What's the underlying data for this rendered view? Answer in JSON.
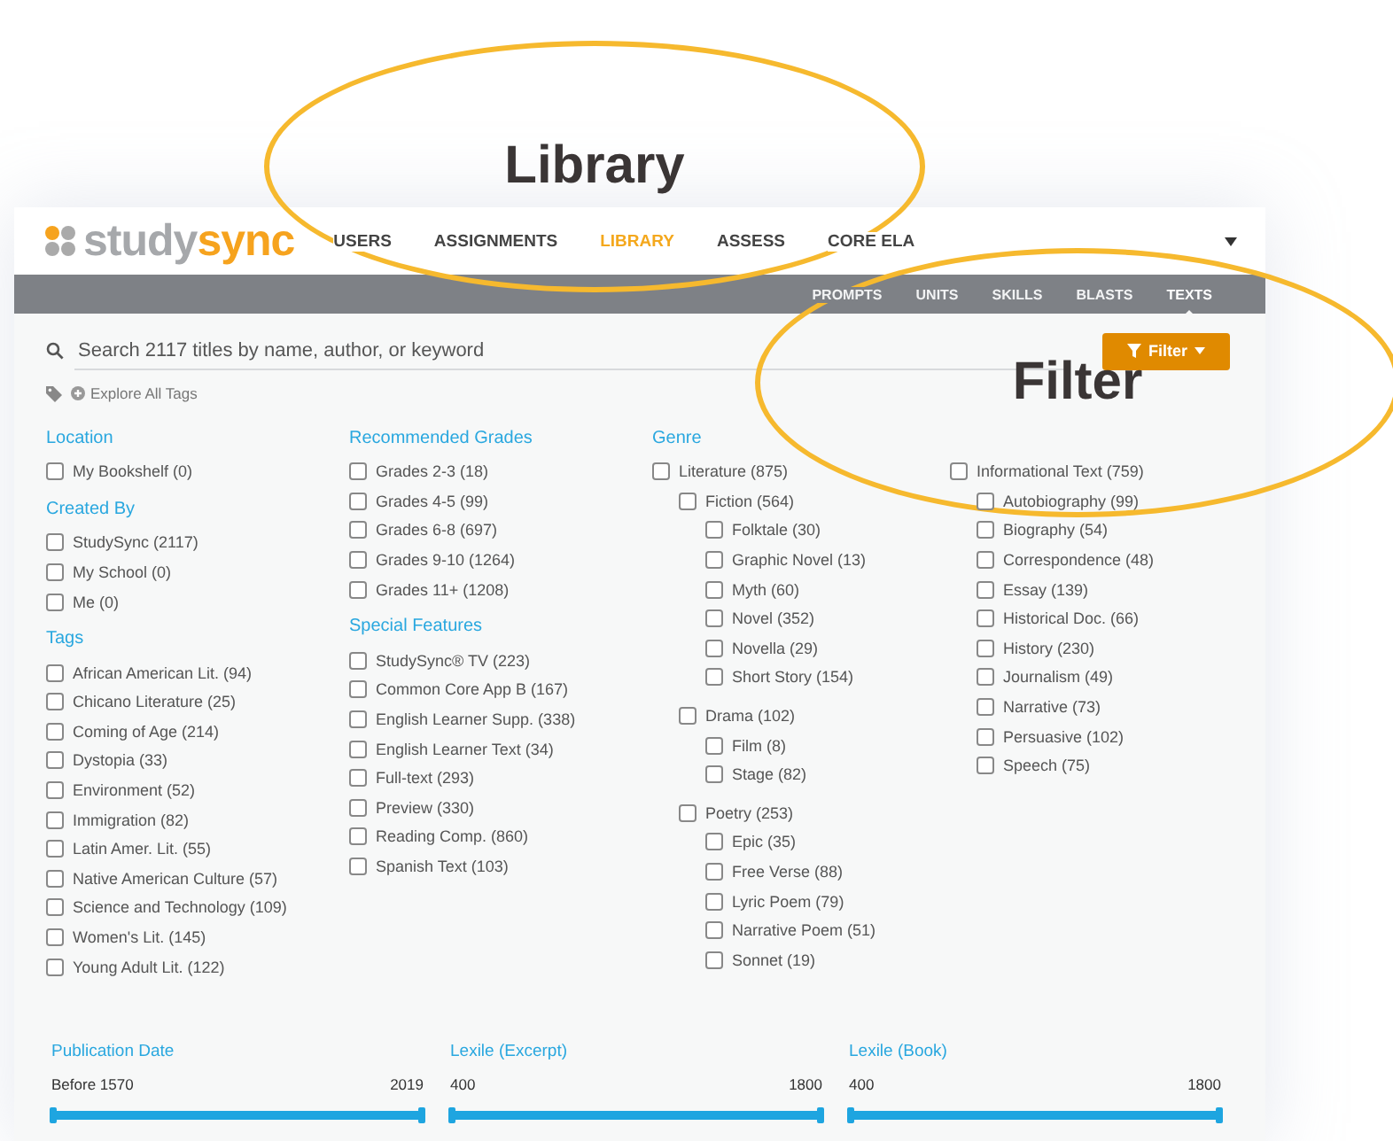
{
  "callouts": [
    {
      "kind": "library",
      "label": "Library"
    },
    {
      "kind": "filter",
      "label": "Filter"
    }
  ],
  "header": {
    "logo": [
      "study",
      "sync"
    ],
    "nav": [
      {
        "label": "USERS",
        "selected": false
      },
      {
        "label": "ASSIGNMENTS",
        "selected": false
      },
      {
        "label": "LIBRARY",
        "selected": true
      },
      {
        "label": "ASSESS",
        "selected": false
      },
      {
        "label": "CORE ELA",
        "selected": false
      }
    ],
    "subnav": [
      {
        "label": "PROMPTS",
        "selected": false
      },
      {
        "label": "UNITS",
        "selected": false
      },
      {
        "label": "SKILLS",
        "selected": false
      },
      {
        "label": "BLASTS",
        "selected": false
      },
      {
        "label": "TEXTS",
        "selected": true
      }
    ]
  },
  "search": {
    "placeholder": "Search 2117 titles by name, author, or keyword"
  },
  "filter_button": {
    "label": "Filter"
  },
  "tags_link": "Explore All Tags",
  "columns": [
    [
      {
        "title": "Location",
        "items": [
          {
            "label": "My Bookshelf (0)",
            "checked": false
          }
        ]
      },
      {
        "title": "Created By",
        "items": [
          {
            "label": "StudySync (2117)",
            "checked": false
          },
          {
            "label": "My School (0)",
            "checked": false
          },
          {
            "label": "Me (0)",
            "checked": false
          }
        ]
      },
      {
        "title": "Tags",
        "items": [
          {
            "label": "African American Lit. (94)",
            "checked": false
          },
          {
            "label": "Chicano Literature (25)",
            "checked": false
          },
          {
            "label": "Coming of Age (214)",
            "checked": false
          },
          {
            "label": "Dystopia (33)",
            "checked": false
          },
          {
            "label": "Environment (52)",
            "checked": false
          },
          {
            "label": "Immigration (82)",
            "checked": false
          },
          {
            "label": "Latin Amer. Lit. (55)",
            "checked": false
          },
          {
            "label": "Native American Culture (57)",
            "checked": false
          },
          {
            "label": "Science and Technology (109)",
            "checked": false
          },
          {
            "label": "Women's Lit. (145)",
            "checked": false
          },
          {
            "label": "Young Adult Lit. (122)",
            "checked": false
          }
        ]
      }
    ],
    [
      {
        "title": "Recommended Grades",
        "items": [
          {
            "label": "Grades 2-3 (18)",
            "checked": false
          },
          {
            "label": "Grades 4-5 (99)",
            "checked": false
          },
          {
            "label": "Grades 6-8 (697)",
            "checked": false
          },
          {
            "label": "Grades 9-10 (1264)",
            "checked": false
          },
          {
            "label": "Grades 11+ (1208)",
            "checked": false
          }
        ]
      },
      {
        "title": "Special Features",
        "items": [
          {
            "label": "StudySync® TV (223)",
            "checked": false
          },
          {
            "label": "Common Core App B (167)",
            "checked": false
          },
          {
            "label": "English Learner Supp. (338)",
            "checked": false
          },
          {
            "label": "English Learner Text (34)",
            "checked": false
          },
          {
            "label": "Full-text (293)",
            "checked": false
          },
          {
            "label": "Preview (330)",
            "checked": false
          },
          {
            "label": "Reading Comp. (860)",
            "checked": false
          },
          {
            "label": "Spanish Text (103)",
            "checked": false
          }
        ]
      }
    ]
  ],
  "genre": {
    "title": "Genre",
    "trees": [
      {
        "label": "Literature (875)",
        "checked": false,
        "children": [
          {
            "label": "Fiction (564)",
            "checked": false,
            "children": [
              {
                "label": "Folktale (30)",
                "checked": false
              },
              {
                "label": "Graphic Novel (13)",
                "checked": false
              },
              {
                "label": "Myth (60)",
                "checked": false
              },
              {
                "label": "Novel (352)",
                "checked": false
              },
              {
                "label": "Novella (29)",
                "checked": false
              },
              {
                "label": "Short Story (154)",
                "checked": false
              }
            ]
          },
          {
            "label": "Drama (102)",
            "checked": false,
            "children": [
              {
                "label": "Film (8)",
                "checked": false
              },
              {
                "label": "Stage (82)",
                "checked": false
              }
            ]
          },
          {
            "label": "Poetry (253)",
            "checked": false,
            "children": [
              {
                "label": "Epic (35)",
                "checked": false
              },
              {
                "label": "Free Verse (88)",
                "checked": false
              },
              {
                "label": "Lyric Poem (79)",
                "checked": false
              },
              {
                "label": "Narrative Poem (51)",
                "checked": false
              },
              {
                "label": "Sonnet (19)",
                "checked": false
              }
            ]
          }
        ]
      },
      {
        "label": "Informational Text (759)",
        "checked": false,
        "children": [
          {
            "label": "Autobiography (99)",
            "checked": false
          },
          {
            "label": "Biography (54)",
            "checked": false
          },
          {
            "label": "Correspondence (48)",
            "checked": false
          },
          {
            "label": "Essay (139)",
            "checked": false
          },
          {
            "label": "Historical Doc. (66)",
            "checked": false
          },
          {
            "label": "History (230)",
            "checked": false
          },
          {
            "label": "Journalism (49)",
            "checked": false
          },
          {
            "label": "Narrative (73)",
            "checked": false
          },
          {
            "label": "Persuasive (102)",
            "checked": false
          },
          {
            "label": "Speech (75)",
            "checked": false
          }
        ]
      }
    ]
  },
  "ranges": [
    {
      "title": "Publication Date",
      "min": "Before 1570",
      "max": "2019",
      "level": 1
    },
    {
      "title": "Lexile (Excerpt)",
      "min": "400",
      "max": "1800",
      "level": 1
    },
    {
      "title": "Lexile (Book)",
      "min": "400",
      "max": "1800",
      "level": 1
    }
  ]
}
